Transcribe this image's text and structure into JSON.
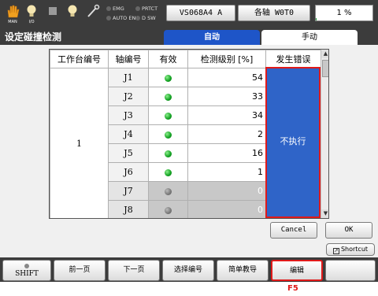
{
  "status_bar": {
    "mode_caption": "MAN",
    "io_caption": "I/O",
    "indicators": [
      {
        "label": "EMG"
      },
      {
        "label": "PRTCT"
      },
      {
        "label": "AUTO EN"
      },
      {
        "label": "D SW"
      }
    ],
    "program_label": "VS068A4 A",
    "axis_label": "各轴 W0T0",
    "speed_percent": "1 %",
    "speed_value": 1
  },
  "page_title": "设定碰撞检测",
  "tabs": [
    {
      "label": "自动",
      "active": true
    },
    {
      "label": "手动",
      "active": false
    }
  ],
  "table": {
    "headers": [
      "工作台编号",
      "轴编号",
      "有效",
      "检测级别 [%]",
      "发生错误"
    ],
    "station": "1",
    "error_value": "不执行",
    "rows": [
      {
        "axis": "J1",
        "valid": true,
        "level": "54"
      },
      {
        "axis": "J2",
        "valid": true,
        "level": "33"
      },
      {
        "axis": "J3",
        "valid": true,
        "level": "34"
      },
      {
        "axis": "J4",
        "valid": true,
        "level": "2"
      },
      {
        "axis": "J5",
        "valid": true,
        "level": "16"
      },
      {
        "axis": "J6",
        "valid": true,
        "level": "1"
      },
      {
        "axis": "J7",
        "valid": false,
        "level": "0"
      },
      {
        "axis": "J8",
        "valid": false,
        "level": "0"
      }
    ]
  },
  "buttons": {
    "cancel": "Cancel",
    "ok": "OK",
    "shortcut": "Shortcut"
  },
  "function_keys": [
    {
      "label": "SHIFT"
    },
    {
      "label": "前一页"
    },
    {
      "label": "下一页"
    },
    {
      "label": "选择编号"
    },
    {
      "label": "简单教导"
    },
    {
      "label": "编辑"
    },
    {
      "label": ""
    }
  ],
  "annotation": "F5",
  "colors": {
    "accent_blue": "#2f64c8",
    "tab_active": "#1e55c8",
    "highlight_red": "#e01a1a",
    "led_on": "#10a020",
    "led_off": "#777777",
    "bar_dark": "#3c3c3c"
  }
}
